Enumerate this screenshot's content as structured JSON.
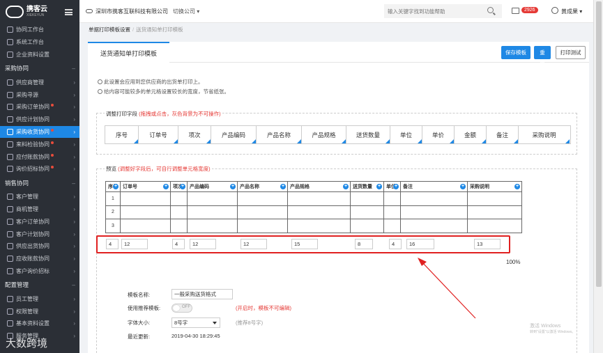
{
  "sidebar": {
    "brand": "携客云",
    "brand_sub": "XIEKEYUN",
    "top_items": [
      "协同工作台",
      "系统工作台",
      "企业资料设置"
    ],
    "groups": [
      {
        "title": "采购协同",
        "items": [
          {
            "label": "供应商管理",
            "dot": false
          },
          {
            "label": "采购寻源",
            "dot": false
          },
          {
            "label": "采购订单协同",
            "dot": true
          },
          {
            "label": "供应计划协同",
            "dot": false
          },
          {
            "label": "采购收货协同",
            "dot": true,
            "active": true
          },
          {
            "label": "来料检验协同",
            "dot": true
          },
          {
            "label": "应付账款协同",
            "dot": true
          },
          {
            "label": "询价招标协同",
            "dot": true
          }
        ]
      },
      {
        "title": "销售协同",
        "items": [
          {
            "label": "客户管理",
            "dot": false
          },
          {
            "label": "商机管理",
            "dot": false
          },
          {
            "label": "客户订单协同",
            "dot": false
          },
          {
            "label": "客户计划协同",
            "dot": false
          },
          {
            "label": "供应出货协同",
            "dot": false
          },
          {
            "label": "应收账款协同",
            "dot": false
          },
          {
            "label": "客户询价招标",
            "dot": false
          }
        ]
      },
      {
        "title": "配置管理",
        "items": [
          {
            "label": "员工管理",
            "dot": false
          },
          {
            "label": "权限管理",
            "dot": false
          },
          {
            "label": "基本资料设置",
            "dot": false
          },
          {
            "label": "服务管理",
            "dot": false
          }
        ]
      }
    ],
    "watermark": "大数跨境"
  },
  "topbar": {
    "company": "深圳市携客互联科技有限公司",
    "switch_label": "切换公司",
    "search_placeholder": "输入关键字找到功能帮助",
    "message_count": "2926",
    "user": "黄成果"
  },
  "breadcrumb": {
    "parent": "单据打印模板设置",
    "current": "送货通知单打印模板"
  },
  "tab": "送货通知单打印模板",
  "buttons": {
    "save": "保存模板",
    "reset": "重置",
    "test": "打印测试"
  },
  "tips": [
    "此设置会应用到您供应商的出货单打印上。",
    "给内容可能较多的单元格设置较长的宽度，节省纸张。"
  ],
  "fields_section": {
    "title": "调整打印字段",
    "hint": "(拖拽或点击，灰色背景为不可操作)"
  },
  "fields": [
    "序号",
    "订单号",
    "项次",
    "产品编码",
    "产品名称",
    "产品规格",
    "送货数量",
    "单位",
    "单价",
    "金额",
    "备注",
    "采购说明"
  ],
  "preview_section": {
    "title": "预览",
    "hint": "(调整好字段后，可自行调整单元格宽度)"
  },
  "preview_columns": [
    "序号",
    "订单号",
    "项次",
    "产品编码",
    "产品名称",
    "产品规格",
    "送货数量",
    "单位",
    "备注",
    "采购说明"
  ],
  "preview_rows": [
    "1",
    "2",
    "3"
  ],
  "column_widths": [
    "4",
    "12",
    "4",
    "12",
    "12",
    "15",
    "8",
    "4",
    "16",
    "13"
  ],
  "zoom": "100%",
  "form": {
    "name_label": "模板名称:",
    "name_value": "一般采购送货格式",
    "recommend_label": "使用推荐模板:",
    "toggle_text": "OFF",
    "recommend_hint": "(开启时，模板不可编辑)",
    "font_label": "字体大小:",
    "font_value": "8号字",
    "font_hint": "(推荐8号字)",
    "updated_label": "最近更新:",
    "updated_value": "2019-04-30 18:29:45"
  },
  "os_watermark": [
    "激活 Windows",
    "转到\"设置\"以激活 Windows。"
  ]
}
